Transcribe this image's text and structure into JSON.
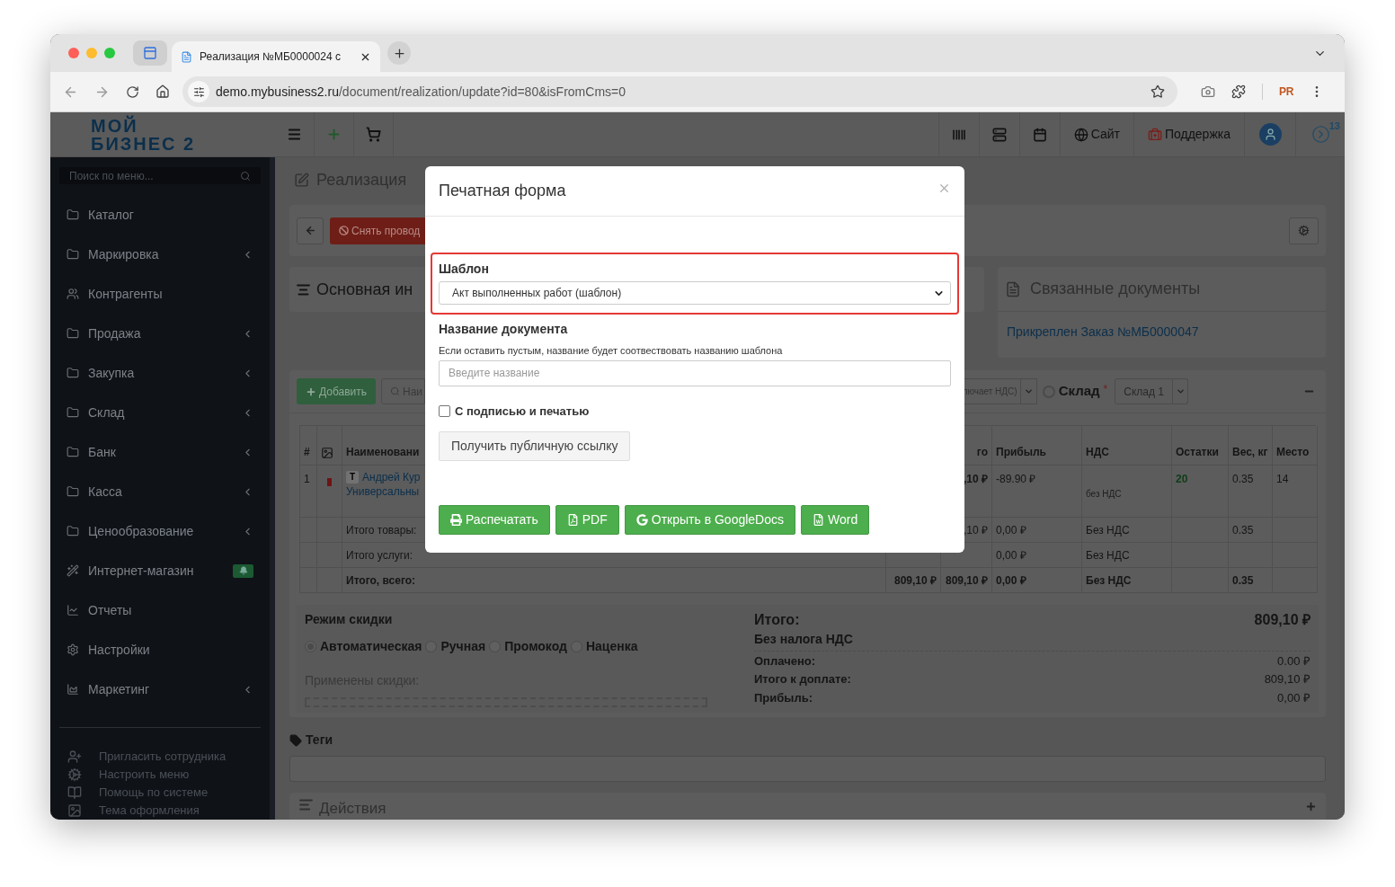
{
  "browser": {
    "tab_title": "Реализация №МБ0000024 с",
    "url_host": "demo.mybusiness2.ru",
    "url_path": "/document/realization/update?id=80&isFromCms=0",
    "profile": "PR"
  },
  "header": {
    "logo_lines": [
      "МОЙ",
      "БИЗНЕС 2"
    ],
    "links": [
      {
        "kind": "site",
        "label": "Сайт"
      },
      {
        "kind": "support",
        "label": "Поддержка"
      }
    ],
    "notification_count": "13"
  },
  "sidebar": {
    "search_placeholder": "Поиск по меню...",
    "items": [
      {
        "label": "Каталог",
        "has_submenu": false,
        "bell": false
      },
      {
        "label": "Маркировка",
        "has_submenu": true,
        "bell": false
      },
      {
        "label": "Контрагенты",
        "has_submenu": false,
        "bell": false
      },
      {
        "label": "Продажа",
        "has_submenu": true,
        "bell": false
      },
      {
        "label": "Закупка",
        "has_submenu": true,
        "bell": false
      },
      {
        "label": "Склад",
        "has_submenu": true,
        "bell": false
      },
      {
        "label": "Банк",
        "has_submenu": true,
        "bell": false
      },
      {
        "label": "Касса",
        "has_submenu": true,
        "bell": false
      },
      {
        "label": "Ценообразование",
        "has_submenu": true,
        "bell": false
      },
      {
        "label": "Интернет-магазин",
        "has_submenu": false,
        "bell": true
      },
      {
        "label": "Отчеты",
        "has_submenu": false,
        "bell": false
      },
      {
        "label": "Настройки",
        "has_submenu": false,
        "bell": false
      },
      {
        "label": "Маркетинг",
        "has_submenu": true,
        "bell": false
      }
    ],
    "footer_items": [
      "Пригласить сотрудника",
      "Настроить меню",
      "Помощь по системе",
      "Тема оформления"
    ]
  },
  "page": {
    "title": "Реализация",
    "unpost_button": "Снять провод",
    "main_info_title": "Основная ин",
    "related": {
      "title": "Связанные документы",
      "link": "Прикреплен Заказ №МБ0000047"
    },
    "products": {
      "add_button": "Добавить",
      "search_placeholder": "Наи",
      "vat_select": "лючает НДС)",
      "warehouse_label": "Склад",
      "required_mark": "*",
      "warehouse_select": "Склад 1",
      "table": {
        "header": {
          "index": "#",
          "name": "Наименовани",
          "total": "го",
          "profit": "Прибыль",
          "vat": "НДС",
          "stock": "Остатки",
          "weight": "Вес, кг",
          "place": "Место"
        },
        "rows": [
          {
            "kind": "item",
            "index": "1",
            "tag": "T",
            "name_lines": [
              "Андрей Кур",
              "Универсальны"
            ],
            "total": ",10 ₽",
            "profit": "-89.90 ₽",
            "vat": "без НДС",
            "stock": "20",
            "weight": "0.35",
            "place": "14"
          },
          {
            "kind": "summary",
            "label": "Итого товары:",
            "total": ",10 ₽",
            "profit": "0,00 ₽",
            "vat": "Без НДС",
            "weight": "0.35"
          },
          {
            "kind": "summary",
            "label": "Итого услуги:",
            "profit": "0,00 ₽",
            "vat": "Без НДС"
          },
          {
            "kind": "grand",
            "label": "Итого, всего:",
            "sum": "809,10 ₽",
            "total": "809,10 ₽",
            "profit": "0,00 ₽",
            "vat": "Без НДС",
            "weight": "0.35"
          }
        ]
      }
    },
    "discount": {
      "title": "Режим скидки",
      "modes": [
        {
          "label": "Автоматическая",
          "selected": true
        },
        {
          "label": "Ручная",
          "selected": false
        },
        {
          "label": "Промокод",
          "selected": false
        },
        {
          "label": "Наценка",
          "selected": false
        }
      ],
      "applied_label": "Применены скидки:"
    },
    "totals": {
      "title": "Итого:",
      "amount": "809,10 ₽",
      "vat_note": "Без налога НДС",
      "lines": [
        {
          "label": "Оплачено:",
          "value": "0.00 ₽"
        },
        {
          "label": "Итого к доплате:",
          "value": "809,10 ₽"
        },
        {
          "label": "Прибыль:",
          "value": "0,00 ₽"
        }
      ]
    },
    "tags_title": "Теги",
    "actions_title": "Действия"
  },
  "modal": {
    "title": "Печатная форма",
    "highlighted": true,
    "template_label": "Шаблон",
    "template_value": "Акт выполненных работ (шаблон)",
    "name_label": "Название документа",
    "name_hint": "Если оставить пустым, название будет соотвествовать названию шаблона",
    "name_placeholder": "Введите название",
    "sign_label": "С подписью и печатью",
    "sign_checked": false,
    "public_link_button": "Получить публичную ссылку",
    "actions": [
      {
        "kind": "print",
        "label": "Распечатать"
      },
      {
        "kind": "pdf",
        "label": "PDF"
      },
      {
        "kind": "google",
        "label": "Открыть в GoogleDocs"
      },
      {
        "kind": "word",
        "label": "Word"
      }
    ]
  }
}
